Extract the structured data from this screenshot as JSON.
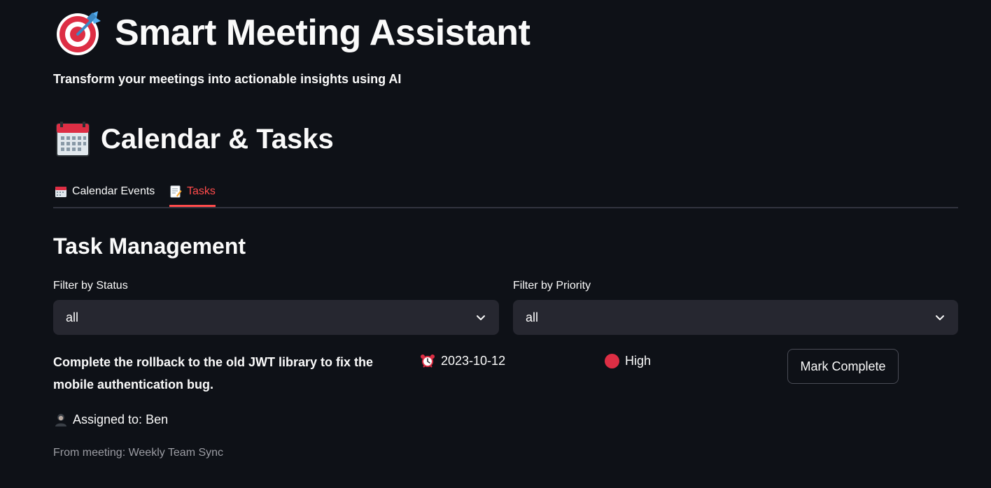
{
  "header": {
    "title": "Smart Meeting Assistant",
    "title_icon": "direct-hit-target-icon",
    "subtitle": "Transform your meetings into actionable insights using AI"
  },
  "section": {
    "title": "Calendar & Tasks",
    "icon": "calendar-icon"
  },
  "tabs": [
    {
      "label": "Calendar Events",
      "icon": "calendar-icon",
      "active": false
    },
    {
      "label": "Tasks",
      "icon": "memo-icon",
      "active": true
    }
  ],
  "task_management": {
    "heading": "Task Management",
    "filters": {
      "status": {
        "label": "Filter by Status",
        "value": "all"
      },
      "priority": {
        "label": "Filter by Priority",
        "value": "all"
      }
    }
  },
  "tasks": [
    {
      "title": "Complete the rollback to the old JWT library to fix the mobile authentication bug.",
      "due_date": "2023-10-12",
      "priority": "High",
      "action_label": "Mark Complete",
      "assigned_to": "Assigned to: Ben",
      "from_meeting": "From meeting: Weekly Team Sync"
    }
  ],
  "colors": {
    "background": "#0e1117",
    "accent": "#ff4b4b",
    "select_bg": "#262730",
    "priority_high": "#dd2e44",
    "muted_text": "#9b9ca3"
  }
}
